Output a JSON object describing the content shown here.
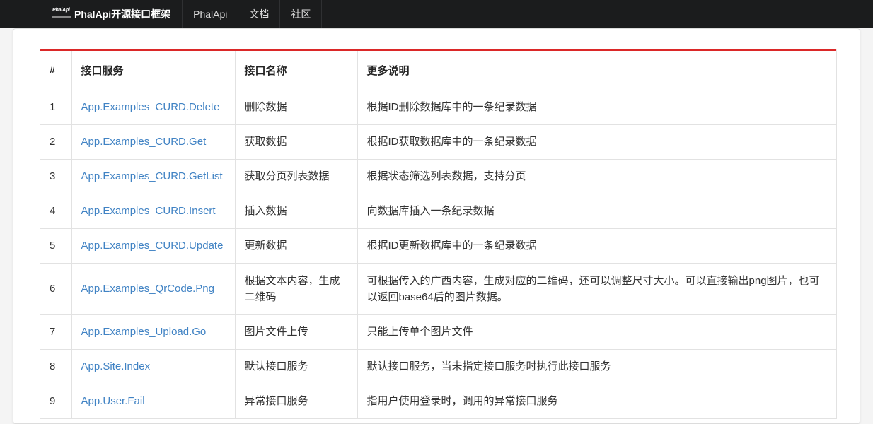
{
  "nav": {
    "logo_text": "PhalApi",
    "brand": "PhalApi开源接口框架",
    "items": [
      "PhalApi",
      "文档",
      "社区"
    ]
  },
  "table": {
    "headers": [
      "#",
      "接口服务",
      "接口名称",
      "更多说明"
    ],
    "rows": [
      {
        "num": "1",
        "service": "App.Examples_CURD.Delete",
        "name": "删除数据",
        "desc": "根据ID删除数据库中的一条纪录数据"
      },
      {
        "num": "2",
        "service": "App.Examples_CURD.Get",
        "name": "获取数据",
        "desc": "根据ID获取数据库中的一条纪录数据"
      },
      {
        "num": "3",
        "service": "App.Examples_CURD.GetList",
        "name": "获取分页列表数据",
        "desc": "根据状态筛选列表数据，支持分页"
      },
      {
        "num": "4",
        "service": "App.Examples_CURD.Insert",
        "name": "插入数据",
        "desc": "向数据库插入一条纪录数据"
      },
      {
        "num": "5",
        "service": "App.Examples_CURD.Update",
        "name": "更新数据",
        "desc": "根据ID更新数据库中的一条纪录数据"
      },
      {
        "num": "6",
        "service": "App.Examples_QrCode.Png",
        "name": "根据文本内容，生成二维码",
        "desc": "可根据传入的广西内容，生成对应的二维码，还可以调整尺寸大小。可以直接输出png图片，也可以返回base64后的图片数据。"
      },
      {
        "num": "7",
        "service": "App.Examples_Upload.Go",
        "name": "图片文件上传",
        "desc": "只能上传单个图片文件"
      },
      {
        "num": "8",
        "service": "App.Site.Index",
        "name": "默认接口服务",
        "desc": "默认接口服务，当未指定接口服务时执行此接口服务"
      },
      {
        "num": "9",
        "service": "App.User.Fail",
        "name": "异常接口服务",
        "desc": "指用户使用登录时，调用的异常接口服务"
      }
    ]
  },
  "colors": {
    "accent": "#db2828",
    "link": "#4183c4",
    "navbar": "#1b1c1d"
  }
}
